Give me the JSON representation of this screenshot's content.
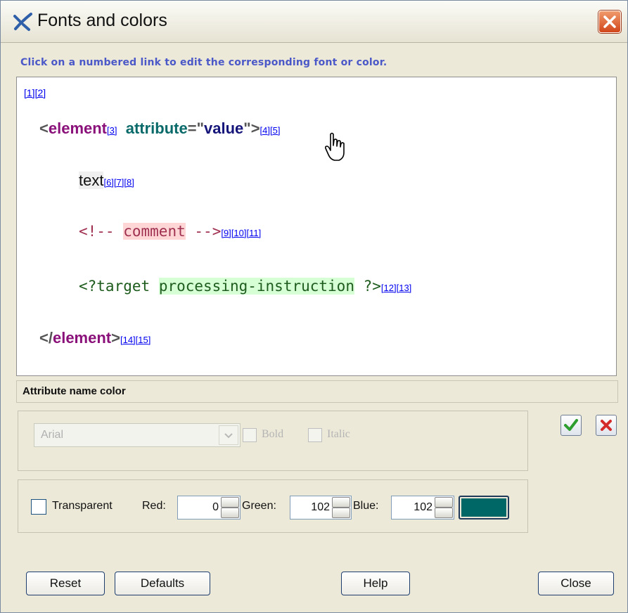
{
  "window": {
    "title": "Fonts and colors"
  },
  "instruction": "Click on a numbered link to edit the corresponding font or color.",
  "preview": {
    "top_links": [
      "[1]",
      "[2]"
    ],
    "element_open": {
      "lt": "<",
      "name": "element",
      "name_links": [
        "[3]"
      ],
      "attr_name": "attribute",
      "eq_quote": "=\"",
      "attr_value": "value",
      "close": "\">",
      "tail_links": [
        "[4]",
        "[5]"
      ]
    },
    "text_line": {
      "text": "text",
      "links": [
        "[6]",
        "[7]",
        "[8]"
      ]
    },
    "comment_line": {
      "open": "<!--",
      "body": "comment",
      "close": "-->",
      "links": [
        "[9]",
        "[10]",
        "[11]"
      ]
    },
    "pi_line": {
      "open": "<?target",
      "body": "processing-instruction",
      "close": "?>",
      "links": [
        "[12]",
        "[13]"
      ]
    },
    "element_close": {
      "lt": "</",
      "name": "element",
      "gt": ">",
      "links": [
        "[14]",
        "[15]"
      ]
    }
  },
  "selection_label": "Attribute name color",
  "font": {
    "family": "Arial",
    "bold_label": "Bold",
    "italic_label": "Italic"
  },
  "color": {
    "transparent_label": "Transparent",
    "red_label": "Red:",
    "red": "0",
    "green_label": "Green:",
    "green": "102",
    "blue_label": "Blue:",
    "blue": "102",
    "swatch_hex": "#006666"
  },
  "buttons": {
    "reset": "Reset",
    "defaults": "Defaults",
    "help": "Help",
    "close": "Close"
  }
}
